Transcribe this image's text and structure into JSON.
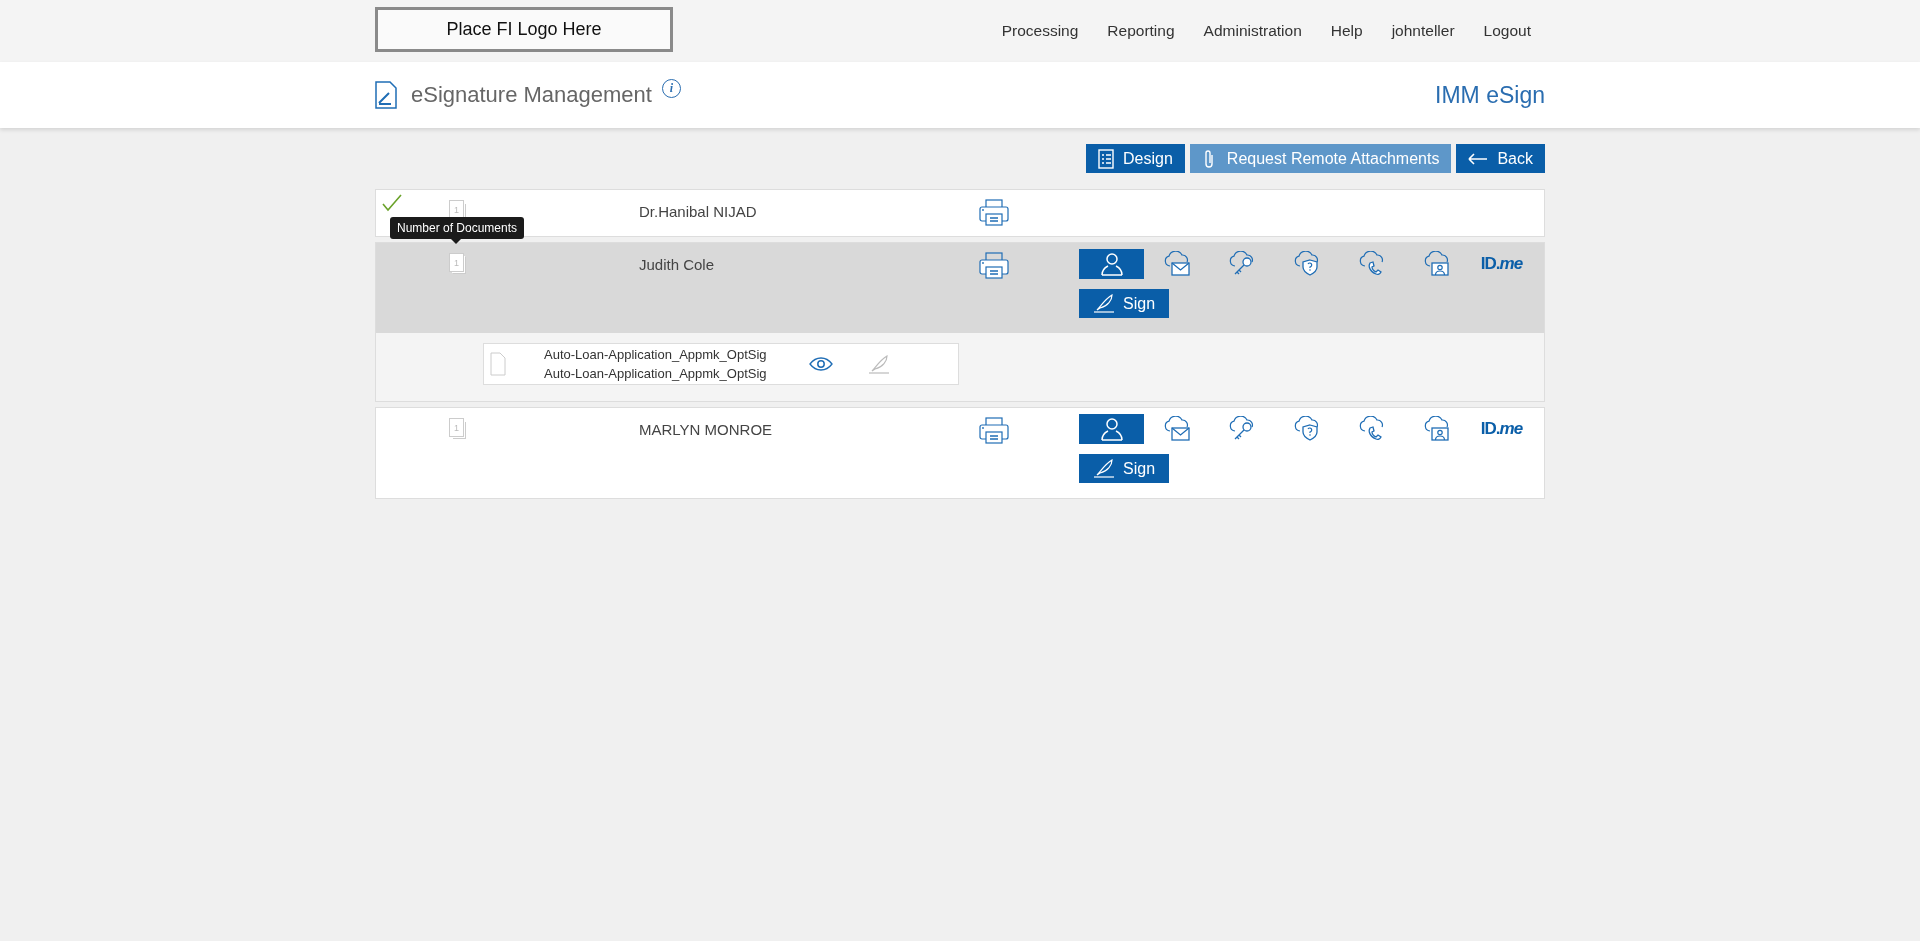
{
  "top_bar": {
    "logo": "Place FI Logo Here",
    "nav": [
      "Processing",
      "Reporting",
      "Administration",
      "Help",
      "johnteller",
      "Logout"
    ]
  },
  "header": {
    "title": "eSignature Management",
    "info": "i",
    "product": "IMM eSign"
  },
  "toolbar": [
    {
      "kind": "design",
      "label": "Design",
      "disabled": false
    },
    {
      "kind": "attach",
      "label": "Request Remote Attachments",
      "disabled": true
    },
    {
      "kind": "back",
      "label": "Back",
      "disabled": false
    }
  ],
  "signers": [
    {
      "signed": true,
      "selected": false,
      "doc_count": "1",
      "name": "Dr.Hanibal NIJAD"
    },
    {
      "signed": false,
      "selected": true,
      "doc_count": "1",
      "name": "Judith Cole",
      "tooltip": "Number of Documents",
      "methods": [
        {
          "kind": "person",
          "selected": true
        },
        {
          "kind": "email",
          "selected": false
        },
        {
          "kind": "key",
          "selected": false
        },
        {
          "kind": "shield",
          "selected": false
        },
        {
          "kind": "phone",
          "selected": false
        },
        {
          "kind": "video",
          "selected": false
        },
        {
          "kind": "idme",
          "selected": false,
          "label": "ID.*me*"
        }
      ],
      "sign_button": "Sign",
      "documents": [
        {
          "name": "Auto-Loan-Application_Appmk_OptSig",
          "description": "Auto-Loan-Application_Appmk_OptSig",
          "sign_enabled": false
        }
      ]
    },
    {
      "signed": false,
      "selected": false,
      "doc_count": "1",
      "name": "MARLYN MONROE",
      "methods": [
        {
          "kind": "person",
          "selected": true
        },
        {
          "kind": "email",
          "selected": false
        },
        {
          "kind": "key",
          "selected": false
        },
        {
          "kind": "shield",
          "selected": false
        },
        {
          "kind": "phone",
          "selected": false
        },
        {
          "kind": "video",
          "selected": false
        },
        {
          "kind": "idme",
          "selected": false,
          "label": "ID.*me*"
        }
      ],
      "sign_button": "Sign"
    }
  ]
}
